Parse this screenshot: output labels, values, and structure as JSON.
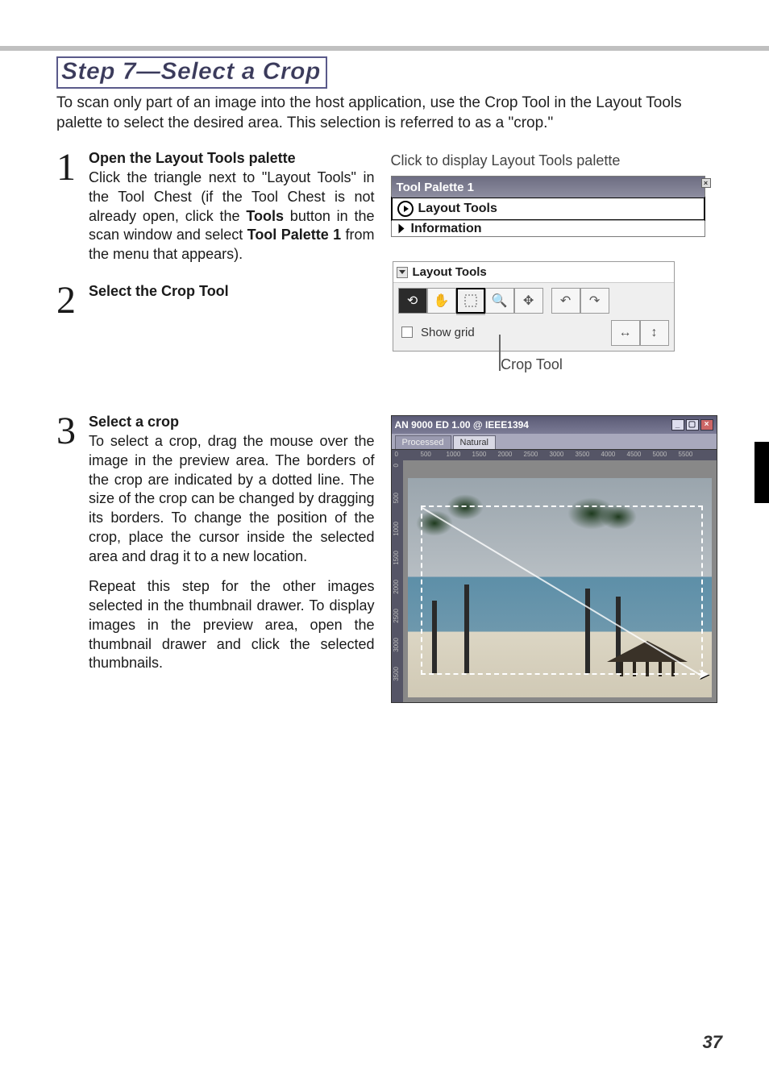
{
  "page_number": "37",
  "step_title": "Step 7—Select a Crop",
  "intro": "To scan only part of an image into the host application, use the Crop Tool in the Layout Tools palette to select the desired area.  This selection is referred to as a \"crop.\"",
  "steps": {
    "s1": {
      "num": "1",
      "head": "Open the Layout Tools palette",
      "body_a": "Click the triangle next to \"Layout Tools\" in the Tool Chest (if the Tool Chest is not already open, click the ",
      "bold_a": "Tools",
      "body_b": " button in the scan window and select ",
      "bold_b": "Tool Palette 1",
      "body_c": " from the menu that appears)."
    },
    "s2": {
      "num": "2",
      "head": "Select the Crop Tool"
    },
    "s3": {
      "num": "3",
      "head": "Select a crop",
      "body_a": "To select a crop, drag the mouse over the image in the preview area.  The borders of the crop are indicated by a dotted line.  The size of the crop can be changed by dragging its borders.  To change the position of the crop, place the cursor inside the selected area and drag it to a new location.",
      "body_b": "Repeat this step for the other images selected in the thumbnail drawer.  To display images in the preview area, open the thumbnail drawer and click the selected thumbnails."
    }
  },
  "right": {
    "caption1": "Click to display Layout Tools palette",
    "caption2": "Crop Tool"
  },
  "tool_palette": {
    "title": "Tool Palette 1",
    "layout_row": "Layout Tools",
    "info_row": "Information"
  },
  "layout_tools_panel": {
    "title": "Layout Tools",
    "show_grid": "Show grid"
  },
  "preview_window": {
    "title": "AN 9000 ED 1.00 @ IEEE1394",
    "tabs": {
      "processed": "Processed",
      "natural": "Natural"
    },
    "ruler_h": [
      "0",
      "500",
      "1000",
      "1500",
      "2000",
      "2500",
      "3000",
      "3500",
      "4000",
      "4500",
      "5000",
      "5500"
    ],
    "ruler_v": [
      "0",
      "500",
      "1000",
      "1500",
      "2000",
      "2500",
      "3000",
      "3500"
    ]
  }
}
